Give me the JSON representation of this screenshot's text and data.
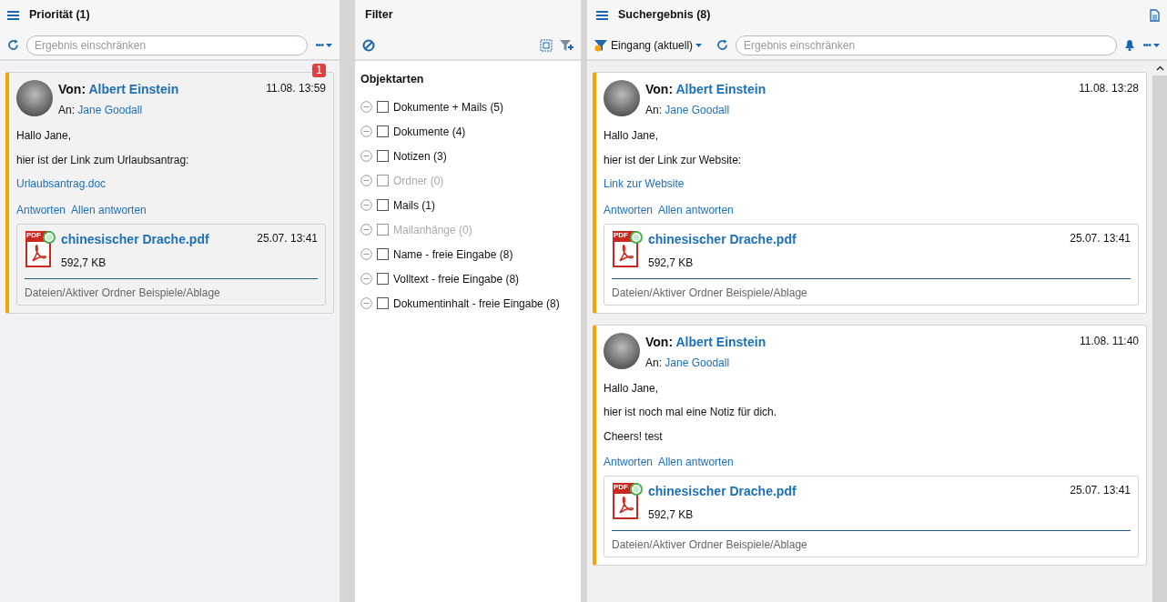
{
  "priority_panel": {
    "title": "Priorität (1)",
    "search": {
      "placeholder": "Ergebnis einschränken"
    },
    "more": "•••",
    "cards": [
      {
        "badge": "1",
        "from_label": "Von:",
        "from": "Albert Einstein",
        "to_label": "An:",
        "to": "Jane Goodall",
        "time": "11.08. 13:59",
        "body": [
          {
            "kind": "text",
            "text": "Hallo Jane,"
          },
          {
            "kind": "text",
            "text": "hier ist der Link zum Urlaubsantrag:"
          },
          {
            "kind": "link",
            "text": "Urlaubsantrag.doc"
          }
        ],
        "actions": [
          "Antworten",
          "Allen antworten"
        ],
        "attachment": {
          "icon_label": "PDF",
          "name": "chinesischer Drache.pdf",
          "size": "592,7 KB",
          "time": "25.07. 13:41",
          "path": "Dateien/Aktiver Ordner Beispiele/Ablage"
        }
      }
    ]
  },
  "filter_panel": {
    "title": "Filter",
    "section": "Objektarten",
    "items": [
      {
        "label": "Dokumente + Mails (5)",
        "checked": false,
        "disabled": false
      },
      {
        "label": "Dokumente (4)",
        "checked": false,
        "disabled": false
      },
      {
        "label": "Notizen (3)",
        "checked": false,
        "disabled": false
      },
      {
        "label": "Ordner (0)",
        "checked": false,
        "disabled": true
      },
      {
        "label": "Mails (1)",
        "checked": false,
        "disabled": false
      },
      {
        "label": "Mailanhänge (0)",
        "checked": false,
        "disabled": true
      },
      {
        "label": "Name - freie Eingabe (8)",
        "checked": false,
        "disabled": false
      },
      {
        "label": "Volltext - freie Eingabe (8)",
        "checked": false,
        "disabled": false
      },
      {
        "label": "Dokumentinhalt - freie Eingabe (8)",
        "checked": false,
        "disabled": false
      }
    ]
  },
  "results_panel": {
    "title": "Suchergebnis (8)",
    "folder": "Eingang (aktuell)",
    "search": {
      "placeholder": "Ergebnis einschränken"
    },
    "more": "•••",
    "cards": [
      {
        "from_label": "Von:",
        "from": "Albert Einstein",
        "to_label": "An:",
        "to": "Jane Goodall",
        "time": "11.08. 13:28",
        "body": [
          {
            "kind": "text",
            "text": "Hallo Jane,"
          },
          {
            "kind": "text",
            "text": "hier ist der Link zur Website:"
          },
          {
            "kind": "link",
            "text": "Link zur Website"
          }
        ],
        "actions": [
          "Antworten",
          "Allen antworten"
        ],
        "attachment": {
          "icon_label": "PDF",
          "name": "chinesischer Drache.pdf",
          "size": "592,7 KB",
          "time": "25.07. 13:41",
          "path": "Dateien/Aktiver Ordner Beispiele/Ablage"
        }
      },
      {
        "from_label": "Von:",
        "from": "Albert Einstein",
        "to_label": "An:",
        "to": "Jane Goodall",
        "time": "11.08. 11:40",
        "body": [
          {
            "kind": "text",
            "text": "Hallo Jane,"
          },
          {
            "kind": "text",
            "text": "hier ist noch mal eine Notiz für dich."
          },
          {
            "kind": "text",
            "text": "Cheers! test"
          }
        ],
        "actions": [
          "Antworten",
          "Allen antworten"
        ],
        "attachment": {
          "icon_label": "PDF",
          "name": "chinesischer Drache.pdf",
          "size": "592,7 KB",
          "time": "25.07. 13:41",
          "path": "Dateien/Aktiver Ordner Beispiele/Ablage"
        }
      }
    ]
  }
}
